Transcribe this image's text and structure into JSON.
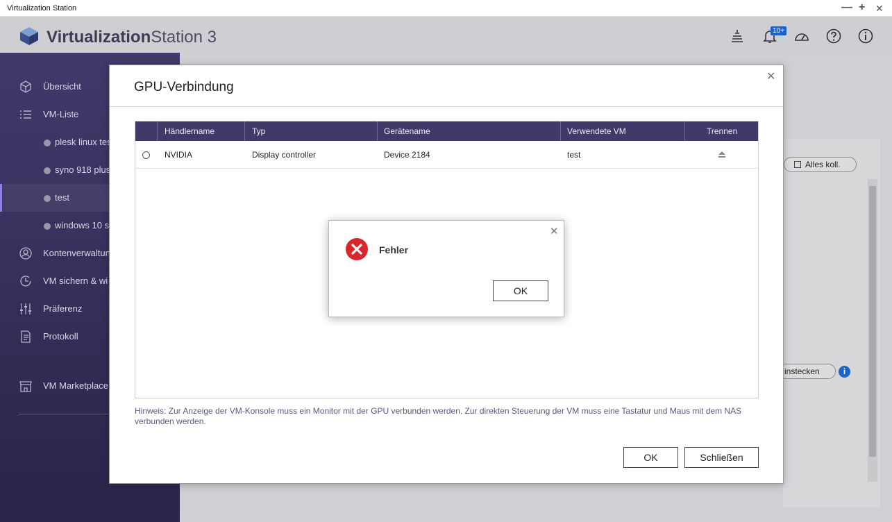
{
  "window": {
    "title": "Virtualization Station",
    "controls": [
      "—",
      "+",
      "✕"
    ]
  },
  "app": {
    "name_bold": "Virtualization",
    "name_rest": "Station 3",
    "notification_badge": "10+"
  },
  "sidebar": {
    "items": [
      {
        "label": "Übersicht",
        "icon": "cube-icon"
      },
      {
        "label": "VM-Liste",
        "icon": "list-icon"
      },
      {
        "label": "plesk linux tes",
        "sub": true
      },
      {
        "label": "syno 918 plus",
        "sub": true
      },
      {
        "label": "test",
        "sub": true,
        "active": true
      },
      {
        "label": "windows 10 s",
        "sub": true
      },
      {
        "label": "Kontenverwaltun",
        "icon": "user-icon"
      },
      {
        "label": "VM sichern & wi",
        "icon": "backup-clock-icon"
      },
      {
        "label": "Präferenz",
        "icon": "sliders-icon"
      },
      {
        "label": "Protokoll",
        "icon": "document-icon"
      },
      {
        "label": "VM Marketplace",
        "icon": "store-icon"
      }
    ]
  },
  "background": {
    "collapse_all": "Alles koll.",
    "insert": "instecken"
  },
  "gpu_dialog": {
    "title": "GPU-Verbindung",
    "columns": [
      "Händlername",
      "Typ",
      "Gerätename",
      "Verwendete VM",
      "Trennen"
    ],
    "rows": [
      {
        "vendor": "NVIDIA",
        "type": "Display controller",
        "device": "Device 2184",
        "vm": "test"
      }
    ],
    "hint": "Hinweis: Zur Anzeige der VM-Konsole muss ein Monitor mit der GPU verbunden werden. Zur direkten Steuerung der VM muss eine Tastatur und Maus mit dem NAS verbunden werden.",
    "ok_label": "OK",
    "close_label": "Schließen"
  },
  "error_dialog": {
    "message": "Fehler",
    "ok_label": "OK"
  },
  "colors": {
    "sidebar": "#3f3a6a",
    "table_header": "#3f3a6a",
    "error_red": "#d9262b",
    "accent_blue": "#1d63c6"
  }
}
